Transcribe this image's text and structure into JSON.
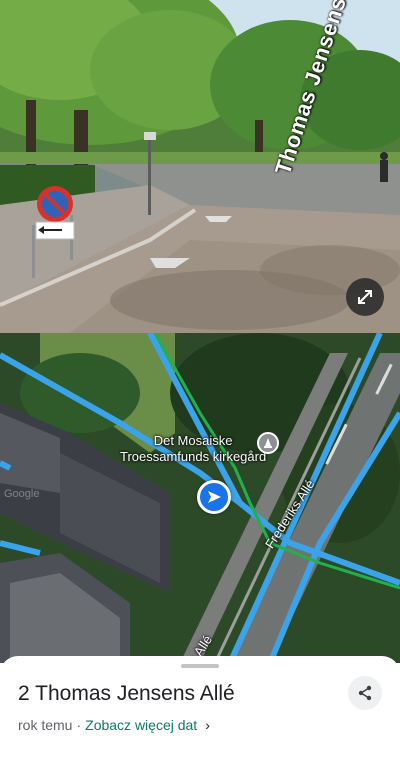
{
  "street_view": {
    "street_sign_text": "Thomas Jensens Allé",
    "expand_icon": "expand-arrows-icon"
  },
  "map": {
    "poi_name_line1": "Det Mosaiske",
    "poi_name_line2": "Troessamfunds kirkegård",
    "poi_icon": "memorial-icon",
    "road_label_1": "Frederiks Allé",
    "road_label_2": "ks Allé",
    "marker_icon": "navigation-arrow-icon",
    "watermark": "Google",
    "colors": {
      "route_blue": "#3aa3ea",
      "route_green": "#22b04b",
      "marker_blue": "#1a73e8"
    }
  },
  "sheet": {
    "title": "2 Thomas Jensens Allé",
    "time_ago": "rok temu",
    "separator": "·",
    "more_dates": "Zobacz więcej dat",
    "chevron": "›",
    "share_icon": "share-icon"
  }
}
